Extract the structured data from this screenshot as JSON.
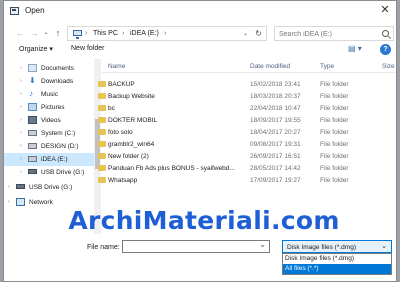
{
  "window": {
    "title": "Open"
  },
  "address": {
    "crumbs": [
      "This PC",
      "iDEA (E:)"
    ],
    "search_placeholder": "Search iDEA (E:)"
  },
  "toolbar": {
    "organize_label": "Organize ▾",
    "new_folder_label": "New folder"
  },
  "nav": {
    "items": [
      {
        "label": "Documents",
        "icon": "documents-icon",
        "indent": 1
      },
      {
        "label": "Downloads",
        "icon": "downloads-icon",
        "indent": 1
      },
      {
        "label": "Music",
        "icon": "music-icon",
        "indent": 1
      },
      {
        "label": "Pictures",
        "icon": "pictures-icon",
        "indent": 1
      },
      {
        "label": "Videos",
        "icon": "videos-icon",
        "indent": 1
      },
      {
        "label": "System (C:)",
        "icon": "drive-icon",
        "indent": 1
      },
      {
        "label": "DESIGN (D:)",
        "icon": "drive-icon",
        "indent": 1
      },
      {
        "label": "iDEA (E:)",
        "icon": "drive-icon",
        "indent": 1,
        "selected": true
      },
      {
        "label": "USB Drive (G:)",
        "icon": "usb-icon",
        "indent": 1
      },
      {
        "label": "USB Drive (G:)",
        "icon": "usb-icon",
        "indent": 0
      },
      {
        "label": "Network",
        "icon": "network-icon",
        "indent": 0
      }
    ]
  },
  "files": {
    "columns": [
      "Name",
      "Date modified",
      "Type",
      "Size"
    ],
    "rows": [
      {
        "name": "BACKUP",
        "date": "15/02/2018 23:41",
        "type": "File folder"
      },
      {
        "name": "Backup Website",
        "date": "18/03/2018 20:37",
        "type": "File folder"
      },
      {
        "name": "bc",
        "date": "22/04/2018 10:47",
        "type": "File folder"
      },
      {
        "name": "DOKTER MOBIL",
        "date": "18/09/2017 19:55",
        "type": "File folder"
      },
      {
        "name": "foto solo",
        "date": "18/04/2017 20:27",
        "type": "File folder"
      },
      {
        "name": "gramblr2_win64",
        "date": "09/08/2017 19:31",
        "type": "File folder"
      },
      {
        "name": "New folder (2)",
        "date": "26/09/2017 16:51",
        "type": "File folder"
      },
      {
        "name": "Panduan Fb Ads plus BONUS - syaifwebd...",
        "date": "28/05/2017 14:42",
        "type": "File folder"
      },
      {
        "name": "Whatsapp",
        "date": "17/09/2017 19:27",
        "type": "File folder"
      }
    ]
  },
  "bottom": {
    "filename_label": "File name:",
    "filename_value": "",
    "filetype_selected": "Disk Image files (*.dmg)",
    "filetype_options": [
      "Disk Image files (*.dmg)",
      "All files (*.*)"
    ]
  },
  "watermark": "ArchiMateriali.com",
  "colors": {
    "accent": "#0078d7",
    "watermark": "#1f5fd6",
    "folder": "#e8c35a",
    "selection": "#cce8ff"
  }
}
